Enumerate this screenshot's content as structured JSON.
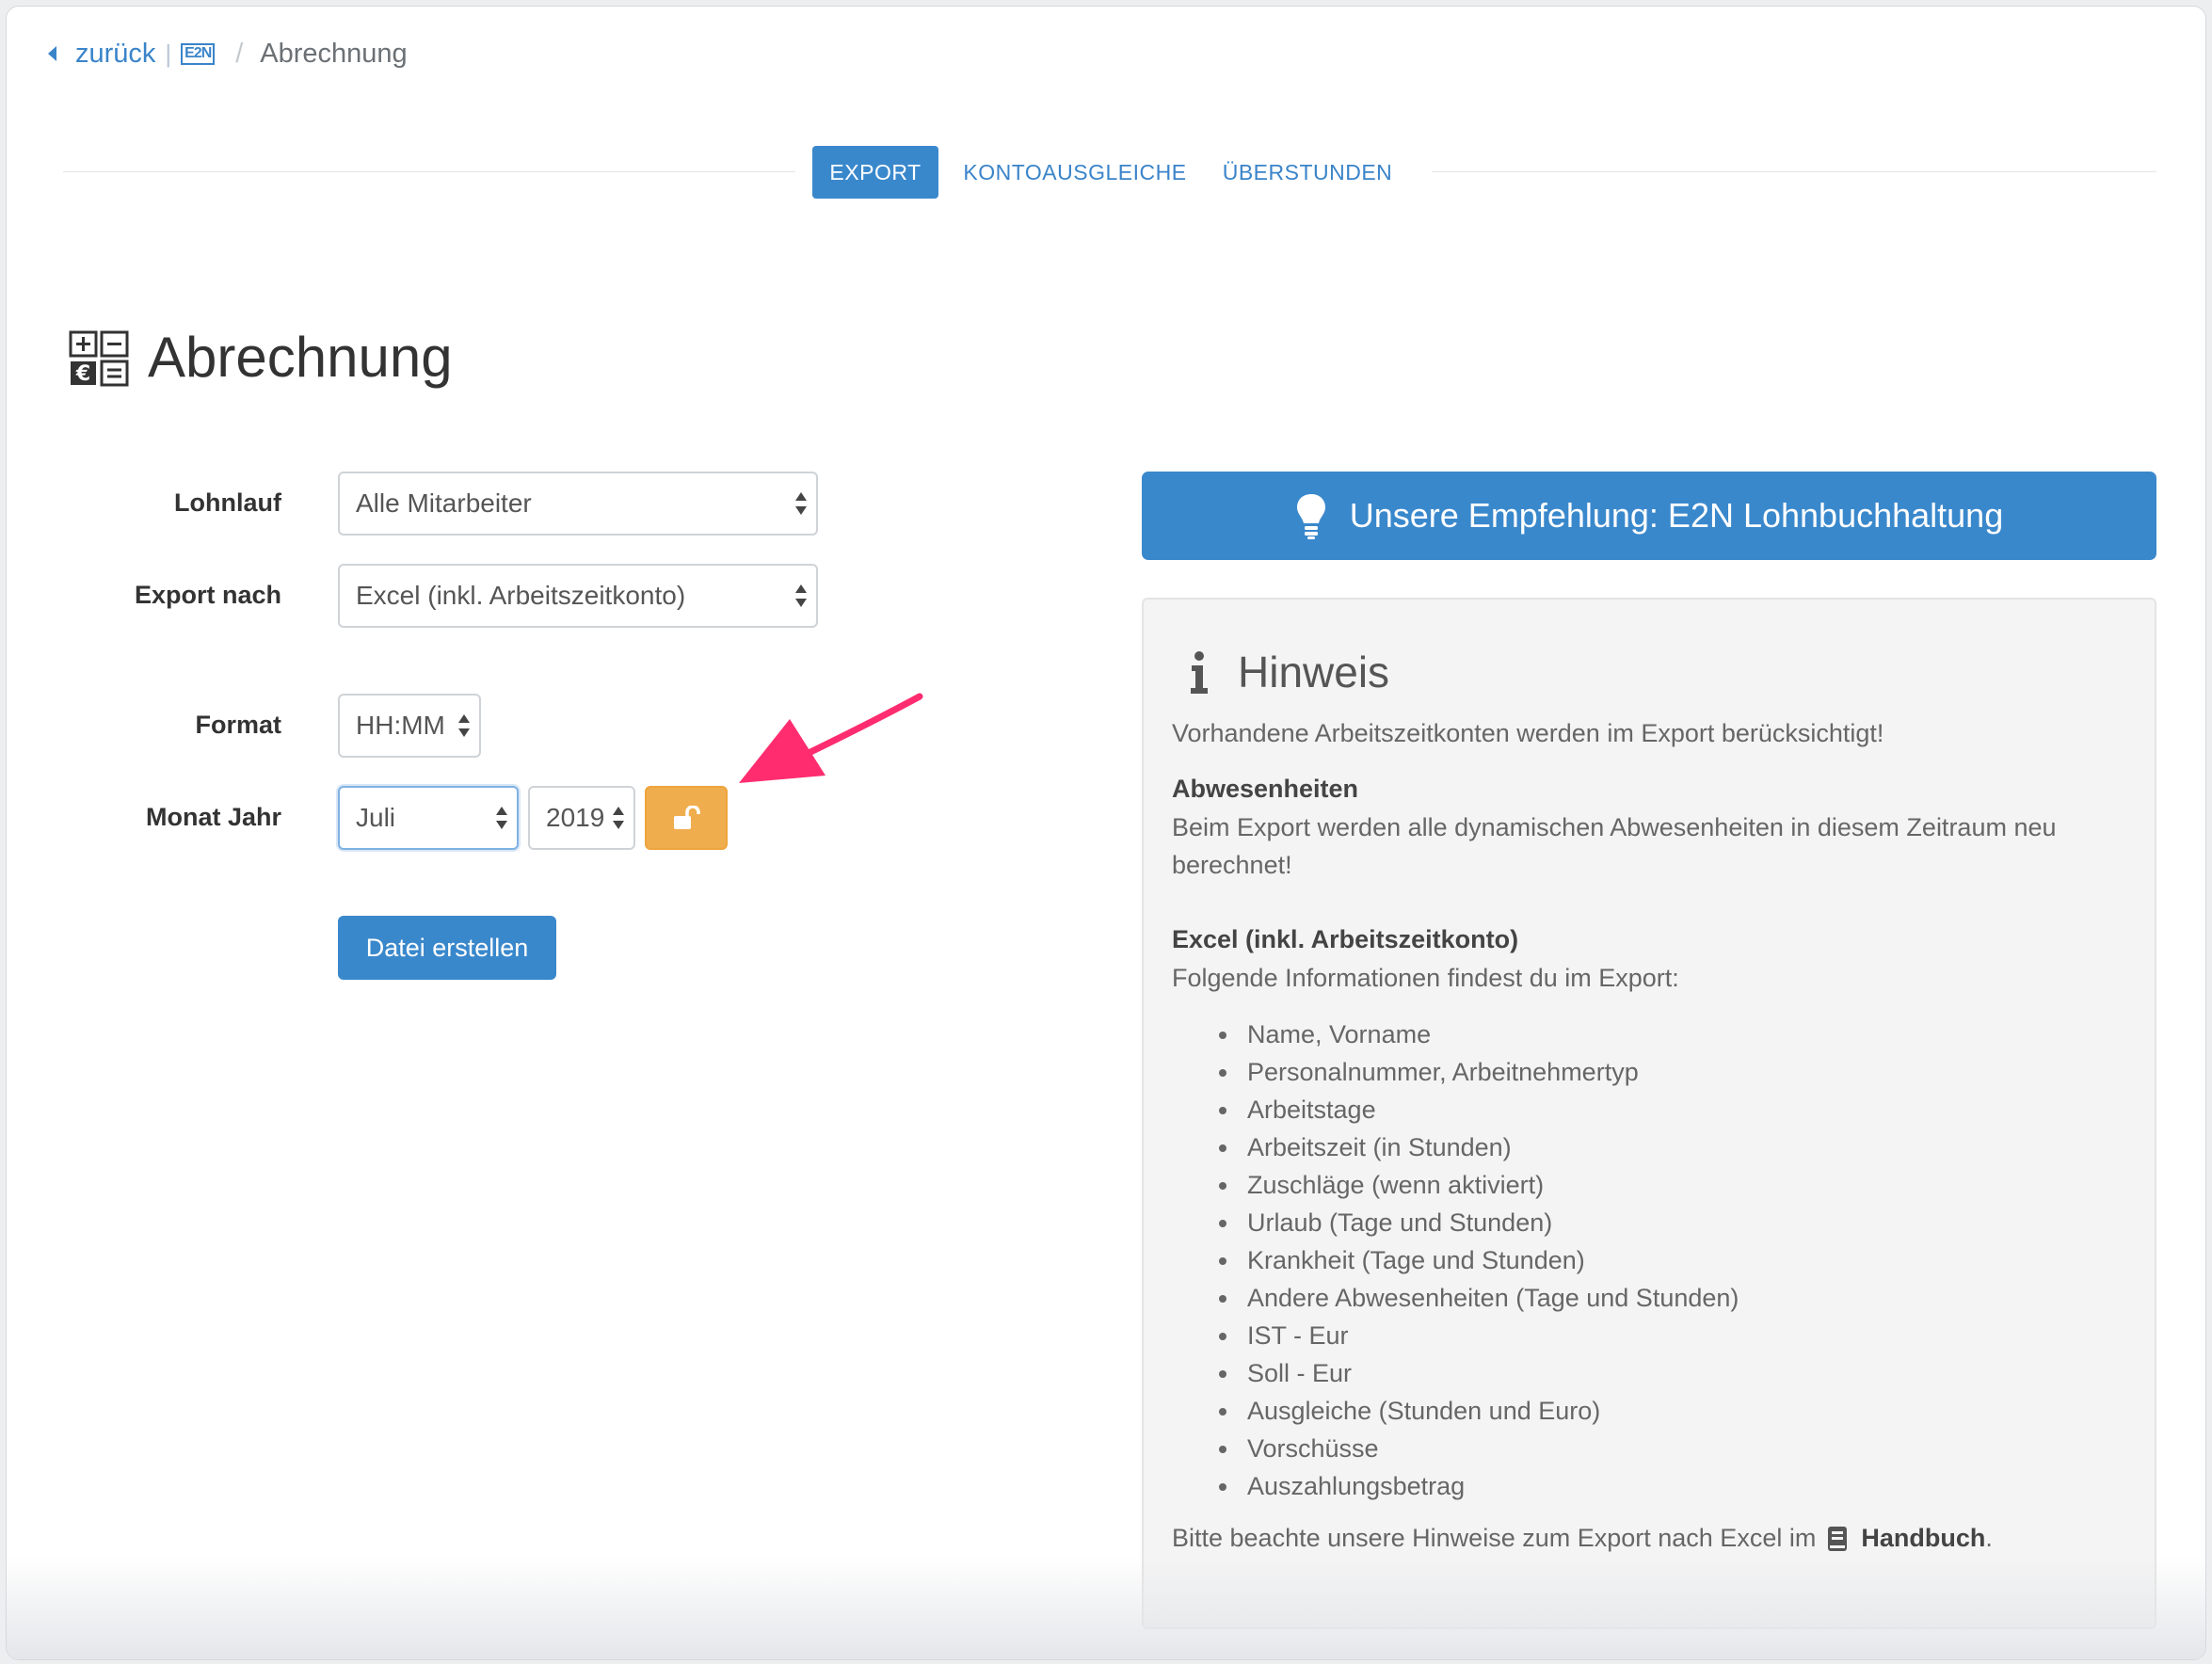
{
  "breadcrumb": {
    "back_label": "zurück",
    "logo_text": "E2N",
    "separator_pipe": "|",
    "separator_slash": "/",
    "current": "Abrechnung"
  },
  "tabs": [
    {
      "label": "EXPORT",
      "active": true
    },
    {
      "label": "KONTOAUSGLEICHE",
      "active": false
    },
    {
      "label": "ÜBERSTUNDEN",
      "active": false
    }
  ],
  "page": {
    "title": "Abrechnung",
    "title_icon": "calculator-icon"
  },
  "form": {
    "lohnlauf": {
      "label": "Lohnlauf",
      "value": "Alle Mitarbeiter"
    },
    "export_nach": {
      "label": "Export nach",
      "value": "Excel (inkl. Arbeitszeitkonto)"
    },
    "format": {
      "label": "Format",
      "value": "HH:MM"
    },
    "monat_jahr": {
      "label": "Monat Jahr",
      "month": "Juli",
      "year": "2019",
      "lock_icon": "unlock-icon"
    },
    "create_button": "Datei erstellen"
  },
  "annotation": {
    "icon": "pointer-arrow-icon",
    "color": "#ff2d6f"
  },
  "recommendation": {
    "label": "Unsere Empfehlung: E2N Lohnbuchhaltung",
    "icon": "lightbulb-icon"
  },
  "hint": {
    "icon": "info-icon",
    "title": "Hinweis",
    "intro": "Vorhandene Arbeitszeitkonten werden im Export berücksichtigt!",
    "absence_title": "Abwesenheiten",
    "absence_text": "Beim Export werden alle dynamischen Abwesenheiten in diesem Zeitraum neu berechnet!",
    "excel_title": "Excel (inkl. Arbeitszeitkonto)",
    "excel_intro": "Folgende Informationen findest du im Export:",
    "items": [
      "Name, Vorname",
      "Personalnummer, Arbeitnehmertyp",
      "Arbeitstage",
      "Arbeitszeit (in Stunden)",
      "Zuschläge (wenn aktiviert)",
      "Urlaub (Tage und Stunden)",
      "Krankheit (Tage und Stunden)",
      "Andere Abwesenheiten (Tage und Stunden)",
      "IST - Eur",
      "Soll - Eur",
      "Ausgleiche (Stunden und Euro)",
      "Vorschüsse",
      "Auszahlungsbetrag"
    ],
    "footer_prefix": "Bitte beachte unsere Hinweise zum Export nach Excel im",
    "footer_link": "Handbuch",
    "footer_suffix": ".",
    "footer_icon": "book-icon"
  },
  "colors": {
    "primary": "#3a88cc",
    "link": "#3a84c9",
    "warning": "#f0ad4e",
    "panel_bg": "#f4f4f4"
  }
}
